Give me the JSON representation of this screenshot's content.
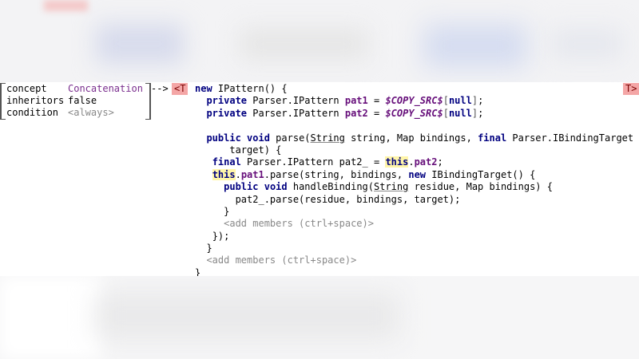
{
  "concept_panel": {
    "concept_key": "concept",
    "concept_value": "Concatenation",
    "inheritors_key": "inheritors",
    "inheritors_value": "false",
    "condition_key": "condition",
    "condition_value": "<always>"
  },
  "arrow": "-->",
  "template_open": "<T",
  "template_close": "T>",
  "code": {
    "l1_new": "new",
    "l1_rest": " IPattern() {",
    "l2_private": "private",
    "l2_type": " Parser.IPattern ",
    "l2_field": "pat1",
    "l2_eq": " = ",
    "l2_macro": "$COPY_SRC$",
    "l2_lb": "[",
    "l2_null": "null",
    "l2_rb": "]",
    "l2_semi": ";",
    "l3_private": "private",
    "l3_type": " Parser.IPattern ",
    "l3_field": "pat2",
    "l3_eq": " = ",
    "l3_macro": "$COPY_SRC$",
    "l3_lb": "[",
    "l3_null": "null",
    "l3_rb": "]",
    "l3_semi": ";",
    "l5_public": "public",
    "l5_void": "void",
    "l5_parse": " parse(",
    "l5_string": "String",
    "l5_mid": " string, Map bindings, ",
    "l5_final": "final",
    "l5_tail": " Parser.IBindingTarget",
    "l6_text": "target) {",
    "l7_final": "final",
    "l7_mid": " Parser.IPattern pat2_ = ",
    "l7_this": "this",
    "l7_dot": ".",
    "l7_field": "pat2",
    "l7_semi": ";",
    "l8_this": "this",
    "l8_dot": ".",
    "l8_field": "pat1",
    "l8_mid": ".parse(string, bindings, ",
    "l8_new": "new",
    "l8_tail": " IBindingTarget() {",
    "l9_public": "public",
    "l9_void": "void",
    "l9_mid": " handleBinding(",
    "l9_string": "String",
    "l9_tail": " residue, Map bindings) {",
    "l10_text": "pat2_.parse(residue, bindings, target);",
    "l11_text": "}",
    "l12_hint": "<add members (ctrl+space)>",
    "l13_text": "});",
    "l14_text": "}",
    "l15_hint": "<add members (ctrl+space)>",
    "l16_text": "}"
  }
}
